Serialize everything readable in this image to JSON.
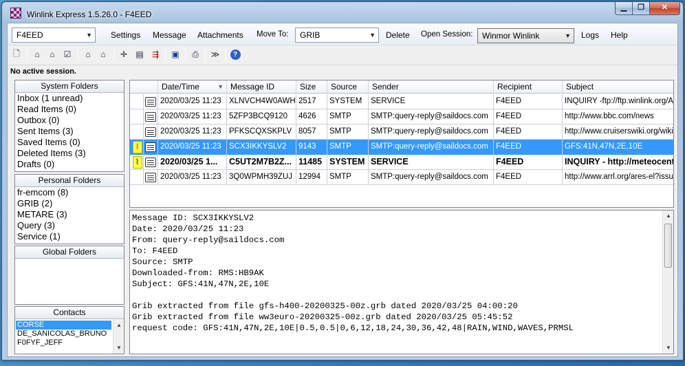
{
  "window": {
    "title": "Winlink Express 1.5.26.0 - F4EED"
  },
  "window_buttons": {
    "minimize": "▁",
    "maximize": "❐",
    "close": "✕"
  },
  "menubar": {
    "callsign": "F4EED",
    "settings": "Settings",
    "message": "Message",
    "attachments": "Attachments",
    "move_to_label": "Move To:",
    "move_to_value": "GRIB",
    "delete": "Delete",
    "open_session_label": "Open Session:",
    "open_session_value": "Winmor Winlink",
    "logs": "Logs",
    "help": "Help"
  },
  "toolbar": {
    "icons": [
      "new-message-icon",
      "attach-icon",
      "attach-multi-icon",
      "check-icon",
      "print-preview-icon",
      "print-icon",
      "crosshair-icon",
      "document-icon",
      "forward-icon",
      "save-icon",
      "printer-icon",
      "send-receive-icon",
      "help-icon"
    ]
  },
  "status": "No active session.",
  "system_folders": {
    "header": "System Folders",
    "items": [
      "Inbox  (1 unread)",
      "Read Items  (0)",
      "Outbox  (0)",
      "Sent Items  (3)",
      "Saved Items  (0)",
      "Deleted Items  (3)",
      "Drafts  (0)"
    ]
  },
  "personal_folders": {
    "header": "Personal Folders",
    "items": [
      "fr-emcom  (8)",
      "GRIB  (2)",
      "METARE  (3)",
      "Query  (3)",
      "Service  (1)"
    ]
  },
  "global_folders": {
    "header": "Global Folders"
  },
  "contacts": {
    "header": "Contacts",
    "items": [
      "CORSE",
      "DE_SANICOLAS_BRUNO",
      "F0FYF_JEFF"
    ]
  },
  "grid": {
    "columns": [
      "Date/Time",
      "Message ID",
      "Size",
      "Source",
      "Sender",
      "Recipient",
      "Subject"
    ],
    "rows": [
      {
        "date": "2020/03/25 11:23",
        "id": "XLNVCH4W0AWH",
        "size": "2517",
        "source": "SYSTEM",
        "sender": "SERVICE",
        "recipient": "F4EED",
        "subject": "INQUIRY -ftp://ftp.winlink.org/Ar",
        "attach": false
      },
      {
        "date": "2020/03/25 11:23",
        "id": "5ZFP3BCQ9120",
        "size": "4626",
        "source": "SMTP",
        "sender": "SMTP:query-reply@saildocs.com",
        "recipient": "F4EED",
        "subject": "http://www.bbc.com/news",
        "attach": false
      },
      {
        "date": "2020/03/25 11:23",
        "id": "PFKSCQXSKPLV",
        "size": "8057",
        "source": "SMTP",
        "sender": "SMTP:query-reply@saildocs.com",
        "recipient": "F4EED",
        "subject": "http://www.cruiserswiki.org/wiki/",
        "attach": false
      },
      {
        "date": "2020/03/25 11:23",
        "id": "SCX3IKKYSLV2",
        "size": "9143",
        "source": "SMTP",
        "sender": "SMTP:query-reply@saildocs.com",
        "recipient": "F4EED",
        "subject": "GFS:41N,47N,2E,10E",
        "attach": true
      },
      {
        "date": "2020/03/25 1...",
        "id": "C5UT2M7B2Z...",
        "size": "11485",
        "source": "SYSTEM",
        "sender": "SERVICE",
        "recipient": "F4EED",
        "subject": "INQUIRY - http://meteocent",
        "attach": true
      },
      {
        "date": "2020/03/25 11:23",
        "id": "3Q0WPMH39ZUJ",
        "size": "12994",
        "source": "SMTP",
        "sender": "SMTP:query-reply@saildocs.com",
        "recipient": "F4EED",
        "subject": "http://www.arrl.org/ares-el?issue-",
        "attach": false
      }
    ]
  },
  "preview": {
    "text": "Message ID: SCX3IKKYSLV2\nDate: 2020/03/25 11:23\nFrom: query-reply@saildocs.com\nTo: F4EED\nSource: SMTP\nDownloaded-from: RMS:HB9AK\nSubject: GFS:41N,47N,2E,10E\n\nGrib extracted from file gfs-h400-20200325-00z.grb dated 2020/03/25 04:00:20\nGrib extracted from file ww3euro-20200325-00z.grb dated 2020/03/25 05:45:52\nrequest code: GFS:41N,47N,2E,10E|0.5,0.5|0,6,12,18,24,30,36,42,48|RAIN,WIND,WAVES,PRMSL"
  },
  "colors": {
    "selection": "#3399ff",
    "attachment_flag": "#ffff44"
  }
}
